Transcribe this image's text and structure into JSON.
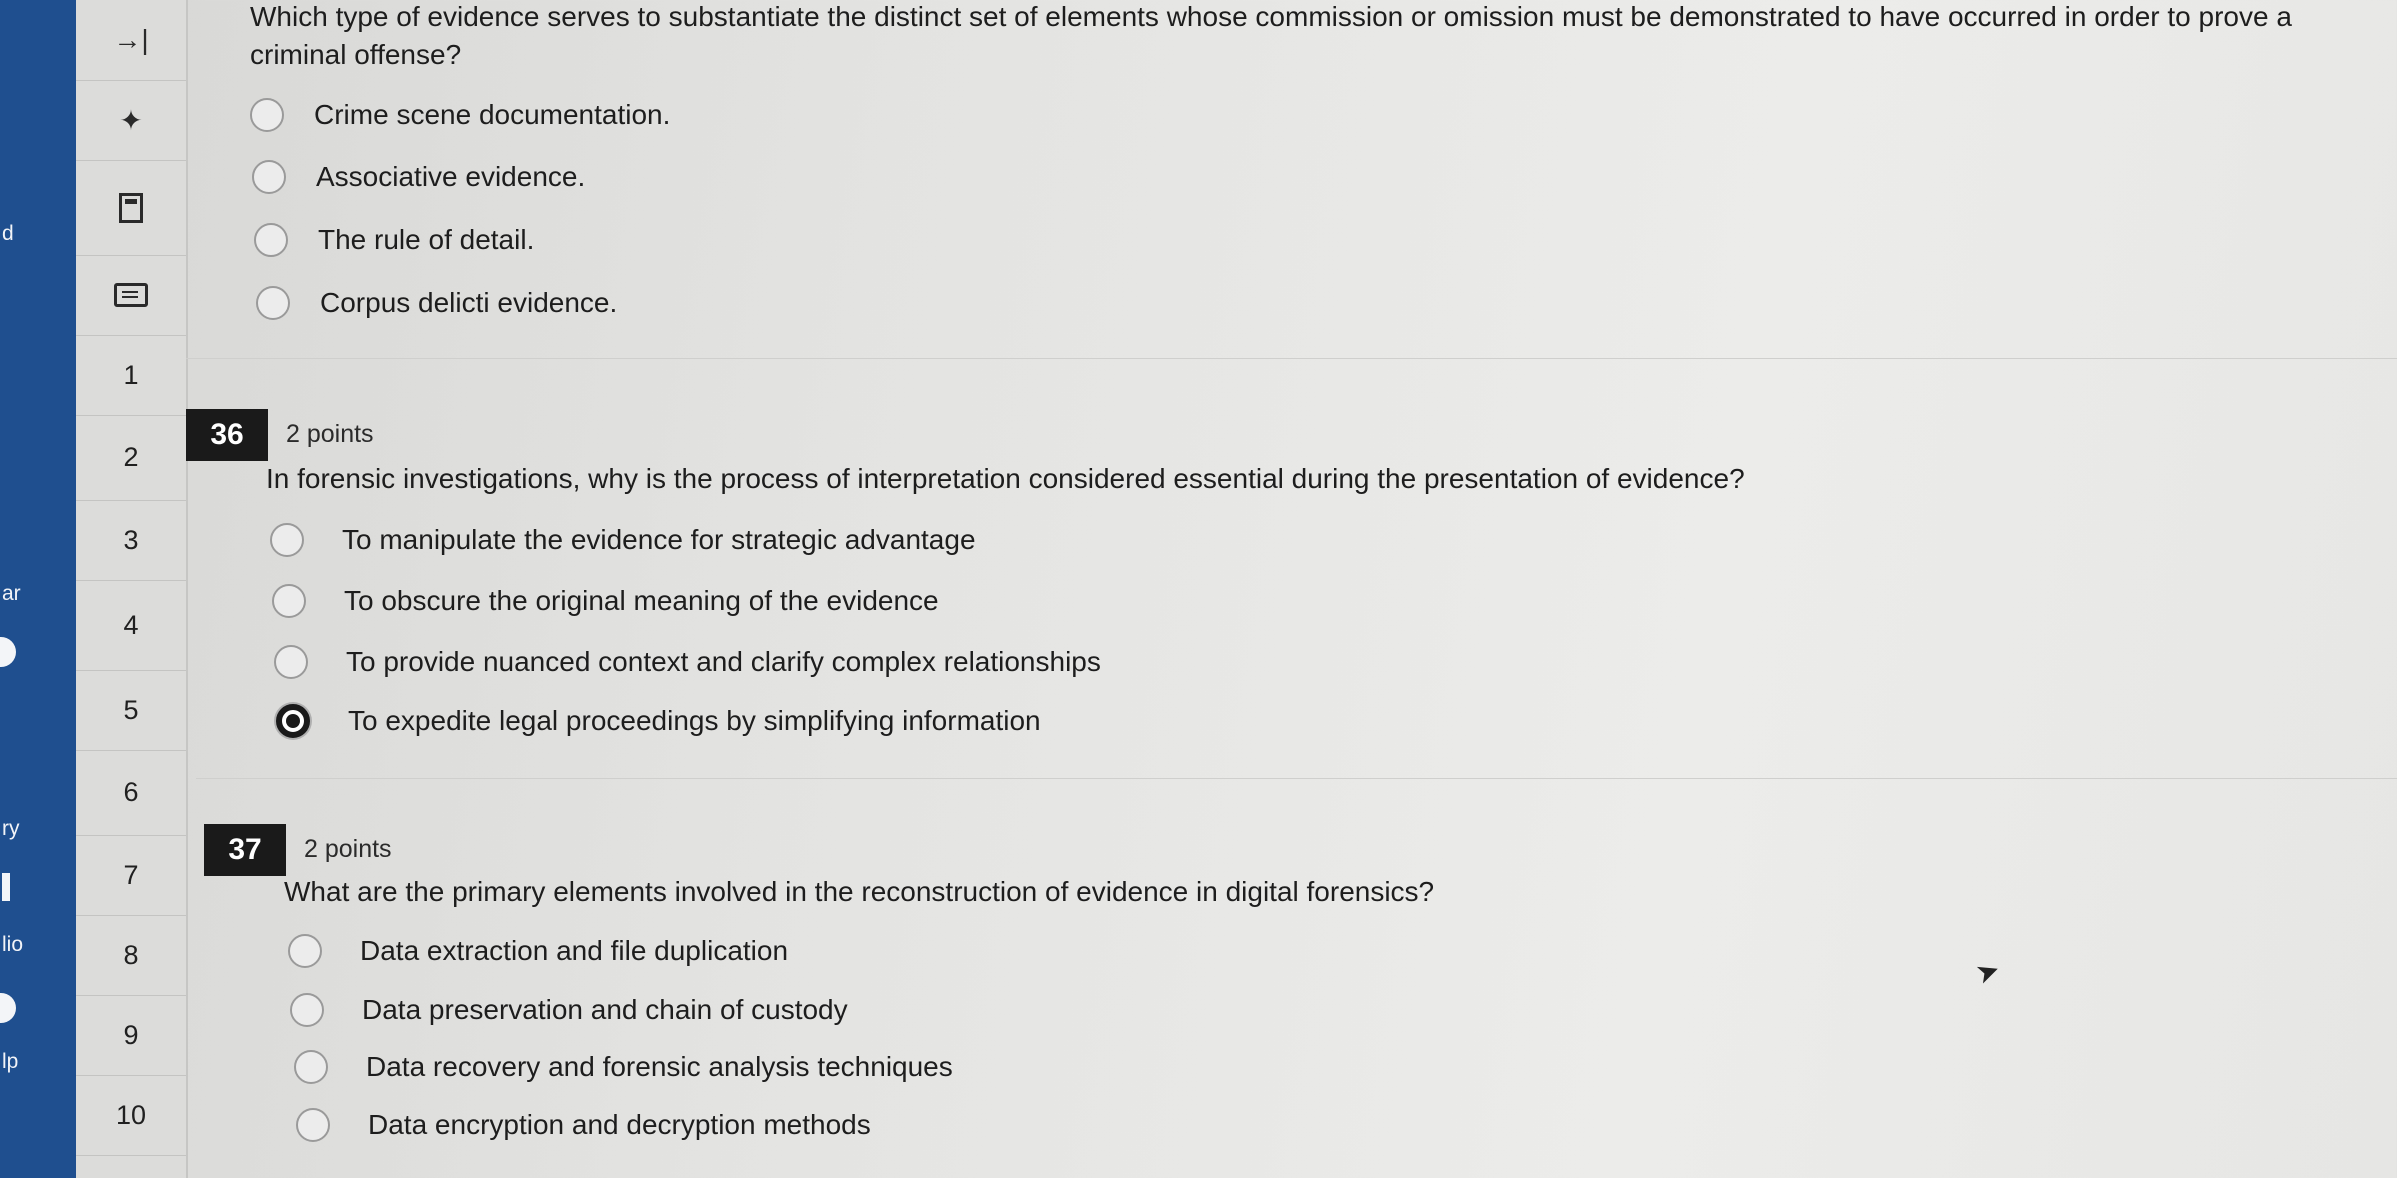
{
  "global_nav": {
    "labels": [
      "d",
      "ar",
      "ry",
      "lio",
      "lp"
    ]
  },
  "question_nav": {
    "collapse_icon": "→|",
    "pin_icon": "✦",
    "items": [
      "1",
      "2",
      "3",
      "4",
      "5",
      "6",
      "7",
      "8",
      "9",
      "10"
    ]
  },
  "questions": [
    {
      "number": "",
      "points": "",
      "text": "Which type of evidence serves to substantiate the distinct set of elements whose commission or omission must be demonstrated to have occurred in order to prove a criminal offense?",
      "options": [
        {
          "label": "Crime scene documentation.",
          "selected": false
        },
        {
          "label": "Associative evidence.",
          "selected": false
        },
        {
          "label": "The rule of detail.",
          "selected": false
        },
        {
          "label": "Corpus delicti evidence.",
          "selected": false
        }
      ]
    },
    {
      "number": "36",
      "points": "2 points",
      "text": "In forensic investigations, why is the process of interpretation considered essential during the presentation of evidence?",
      "options": [
        {
          "label": "To manipulate the evidence for strategic advantage",
          "selected": false
        },
        {
          "label": "To obscure the original meaning of the evidence",
          "selected": false
        },
        {
          "label": "To provide nuanced context and clarify complex relationships",
          "selected": false
        },
        {
          "label": "To expedite legal proceedings by simplifying information",
          "selected": true
        }
      ]
    },
    {
      "number": "37",
      "points": "2 points",
      "text": "What are the primary elements involved in the reconstruction of evidence in digital forensics?",
      "options": [
        {
          "label": "Data extraction and file duplication",
          "selected": false
        },
        {
          "label": "Data preservation and chain of custody",
          "selected": false
        },
        {
          "label": "Data recovery and forensic analysis techniques",
          "selected": false
        },
        {
          "label": "Data encryption and decryption methods",
          "selected": false
        }
      ]
    }
  ],
  "colors": {
    "global_nav_bg": "#1f4f8f",
    "badge_bg": "#1a1a1a",
    "selected_radio": "#1a1a1a"
  }
}
